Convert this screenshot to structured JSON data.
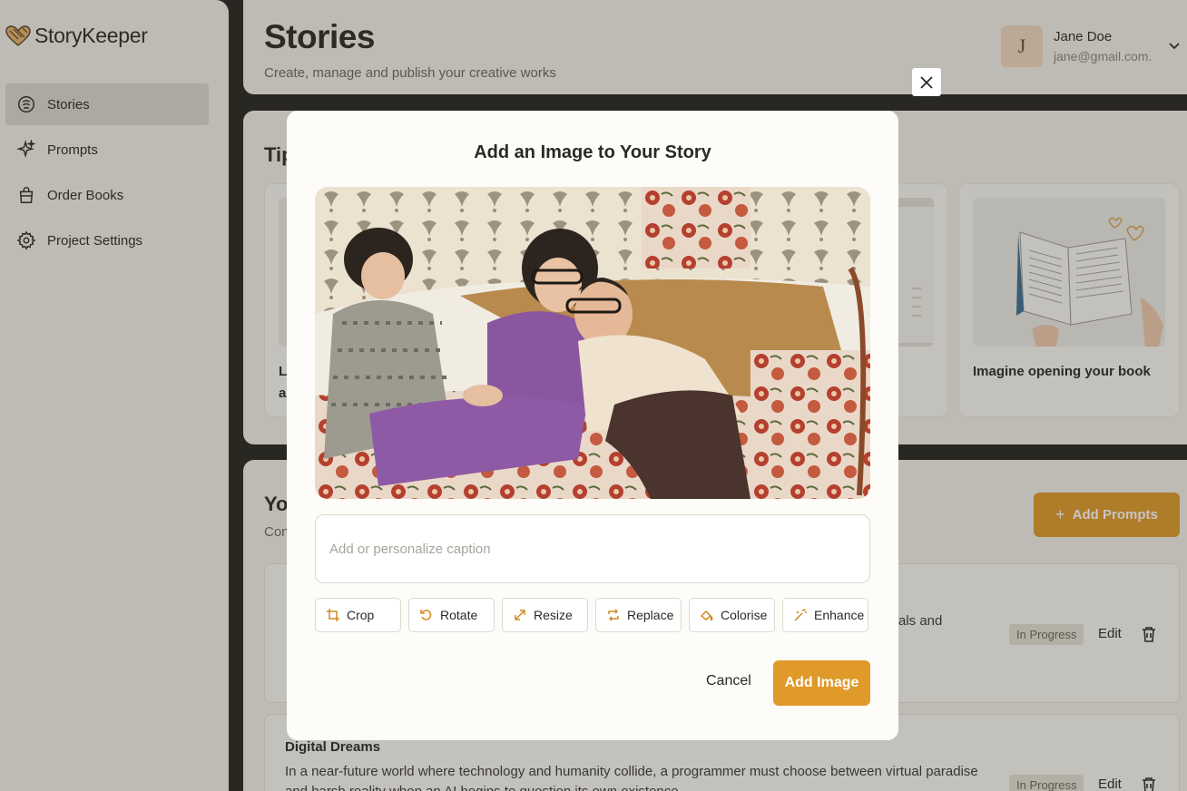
{
  "app": {
    "name": "StoryKeeper"
  },
  "sidebar": {
    "items": [
      {
        "label": "Stories",
        "icon": "stories-icon",
        "active": true
      },
      {
        "label": "Prompts",
        "icon": "sparkle-icon",
        "active": false
      },
      {
        "label": "Order Books",
        "icon": "bag-icon",
        "active": false
      },
      {
        "label": "Project Settings",
        "icon": "gear-icon",
        "active": false
      }
    ]
  },
  "header": {
    "title": "Stories",
    "subtitle": "Create, manage and publish your creative works",
    "user": {
      "initial": "J",
      "name": "Jane Doe",
      "email": "jane@gmail.com."
    }
  },
  "tips": {
    "title": "Tip",
    "cards": [
      {
        "caption": "Le"
      },
      {
        "caption": ""
      },
      {
        "caption": "Imagine opening your book"
      }
    ],
    "card0_line2": "a"
  },
  "stories": {
    "title": "You",
    "subtitle": "Con",
    "add_prompts_label": "Add Prompts",
    "rows": [
      {
        "name": "",
        "desc_visible": "als and",
        "status": "In Progress",
        "edit": "Edit"
      },
      {
        "name": "Digital Dreams",
        "desc": "In a near-future world where technology and humanity collide, a programmer must choose between virtual paradise",
        "desc2": "and harsh reality when an AI begins to question its own existence.",
        "status": "In Progress",
        "edit": "Edit"
      }
    ]
  },
  "modal": {
    "title": "Add an Image to Your Story",
    "caption_placeholder": "Add or personalize caption",
    "tools": [
      {
        "label": "Crop",
        "icon": "crop-icon"
      },
      {
        "label": "Rotate",
        "icon": "rotate-icon"
      },
      {
        "label": "Resize",
        "icon": "resize-icon"
      },
      {
        "label": "Replace",
        "icon": "replace-icon"
      },
      {
        "label": "Colorise",
        "icon": "colorise-icon"
      },
      {
        "label": "Enhance",
        "icon": "enhance-icon"
      }
    ],
    "cancel_label": "Cancel",
    "add_label": "Add Image"
  },
  "colors": {
    "accent": "#e09a2a",
    "sidebar_active": "#dcd9d0",
    "panel": "#f4f2ec"
  }
}
